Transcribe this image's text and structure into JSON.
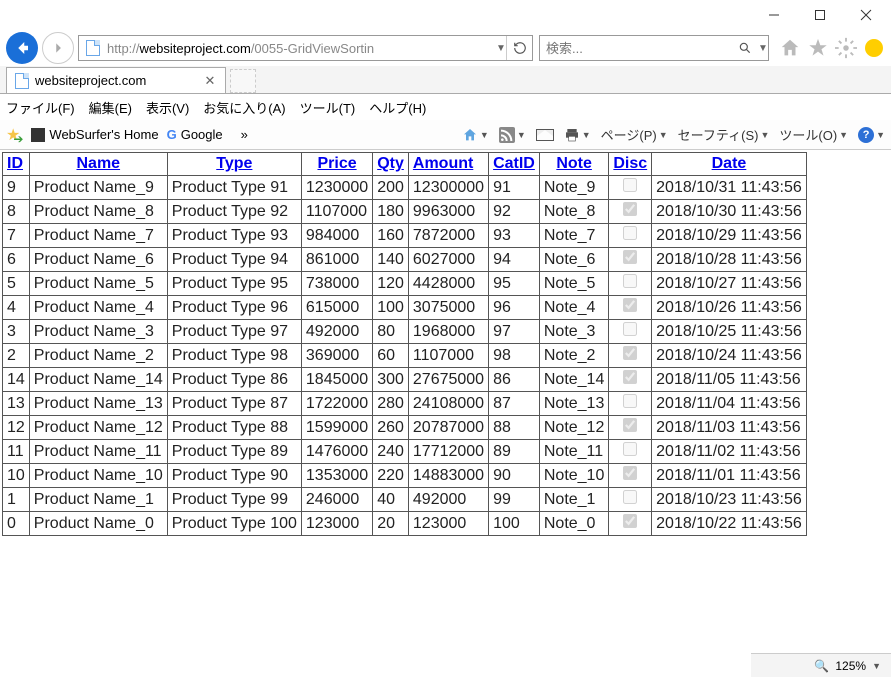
{
  "window": {
    "url_proto": "http://",
    "url_domain": "websiteproject.com",
    "url_path": "/0055-GridViewSortin",
    "search_placeholder": "検索...",
    "tab_title": "websiteproject.com"
  },
  "menu": {
    "file": "ファイル(F)",
    "edit": "編集(E)",
    "view": "表示(V)",
    "favorites": "お気に入り(A)",
    "tools": "ツール(T)",
    "help": "ヘルプ(H)"
  },
  "favbar": {
    "item1": "WebSurfer's Home",
    "item2": "Google",
    "overflow": "»",
    "page": "ページ(P)",
    "safety": "セーフティ(S)",
    "tools": "ツール(O)"
  },
  "grid": {
    "headers": {
      "id": "ID",
      "name": "Name",
      "type": "Type",
      "price": "Price",
      "qty": "Qty",
      "amount": "Amount",
      "catid": "CatID",
      "note": "Note",
      "disc": "Disc",
      "date": "Date"
    },
    "rows": [
      {
        "id": "9",
        "name": "Product Name_9",
        "type": "Product Type 91",
        "price": "1230000",
        "qty": "200",
        "amount": "12300000",
        "catid": "91",
        "note": "Note_9",
        "disc": false,
        "date": "2018/10/31 11:43:56"
      },
      {
        "id": "8",
        "name": "Product Name_8",
        "type": "Product Type 92",
        "price": "1107000",
        "qty": "180",
        "amount": "9963000",
        "catid": "92",
        "note": "Note_8",
        "disc": true,
        "date": "2018/10/30 11:43:56"
      },
      {
        "id": "7",
        "name": "Product Name_7",
        "type": "Product Type 93",
        "price": "984000",
        "qty": "160",
        "amount": "7872000",
        "catid": "93",
        "note": "Note_7",
        "disc": false,
        "date": "2018/10/29 11:43:56"
      },
      {
        "id": "6",
        "name": "Product Name_6",
        "type": "Product Type 94",
        "price": "861000",
        "qty": "140",
        "amount": "6027000",
        "catid": "94",
        "note": "Note_6",
        "disc": true,
        "date": "2018/10/28 11:43:56"
      },
      {
        "id": "5",
        "name": "Product Name_5",
        "type": "Product Type 95",
        "price": "738000",
        "qty": "120",
        "amount": "4428000",
        "catid": "95",
        "note": "Note_5",
        "disc": false,
        "date": "2018/10/27 11:43:56"
      },
      {
        "id": "4",
        "name": "Product Name_4",
        "type": "Product Type 96",
        "price": "615000",
        "qty": "100",
        "amount": "3075000",
        "catid": "96",
        "note": "Note_4",
        "disc": true,
        "date": "2018/10/26 11:43:56"
      },
      {
        "id": "3",
        "name": "Product Name_3",
        "type": "Product Type 97",
        "price": "492000",
        "qty": "80",
        "amount": "1968000",
        "catid": "97",
        "note": "Note_3",
        "disc": false,
        "date": "2018/10/25 11:43:56"
      },
      {
        "id": "2",
        "name": "Product Name_2",
        "type": "Product Type 98",
        "price": "369000",
        "qty": "60",
        "amount": "1107000",
        "catid": "98",
        "note": "Note_2",
        "disc": true,
        "date": "2018/10/24 11:43:56"
      },
      {
        "id": "14",
        "name": "Product Name_14",
        "type": "Product Type 86",
        "price": "1845000",
        "qty": "300",
        "amount": "27675000",
        "catid": "86",
        "note": "Note_14",
        "disc": true,
        "date": "2018/11/05 11:43:56"
      },
      {
        "id": "13",
        "name": "Product Name_13",
        "type": "Product Type 87",
        "price": "1722000",
        "qty": "280",
        "amount": "24108000",
        "catid": "87",
        "note": "Note_13",
        "disc": false,
        "date": "2018/11/04 11:43:56"
      },
      {
        "id": "12",
        "name": "Product Name_12",
        "type": "Product Type 88",
        "price": "1599000",
        "qty": "260",
        "amount": "20787000",
        "catid": "88",
        "note": "Note_12",
        "disc": true,
        "date": "2018/11/03 11:43:56"
      },
      {
        "id": "11",
        "name": "Product Name_11",
        "type": "Product Type 89",
        "price": "1476000",
        "qty": "240",
        "amount": "17712000",
        "catid": "89",
        "note": "Note_11",
        "disc": false,
        "date": "2018/11/02 11:43:56"
      },
      {
        "id": "10",
        "name": "Product Name_10",
        "type": "Product Type 90",
        "price": "1353000",
        "qty": "220",
        "amount": "14883000",
        "catid": "90",
        "note": "Note_10",
        "disc": true,
        "date": "2018/11/01 11:43:56"
      },
      {
        "id": "1",
        "name": "Product Name_1",
        "type": "Product Type 99",
        "price": "246000",
        "qty": "40",
        "amount": "492000",
        "catid": "99",
        "note": "Note_1",
        "disc": false,
        "date": "2018/10/23 11:43:56"
      },
      {
        "id": "0",
        "name": "Product Name_0",
        "type": "Product Type 100",
        "price": "123000",
        "qty": "20",
        "amount": "123000",
        "catid": "100",
        "note": "Note_0",
        "disc": true,
        "date": "2018/10/22 11:43:56"
      }
    ]
  },
  "status": {
    "zoom": "125%"
  }
}
